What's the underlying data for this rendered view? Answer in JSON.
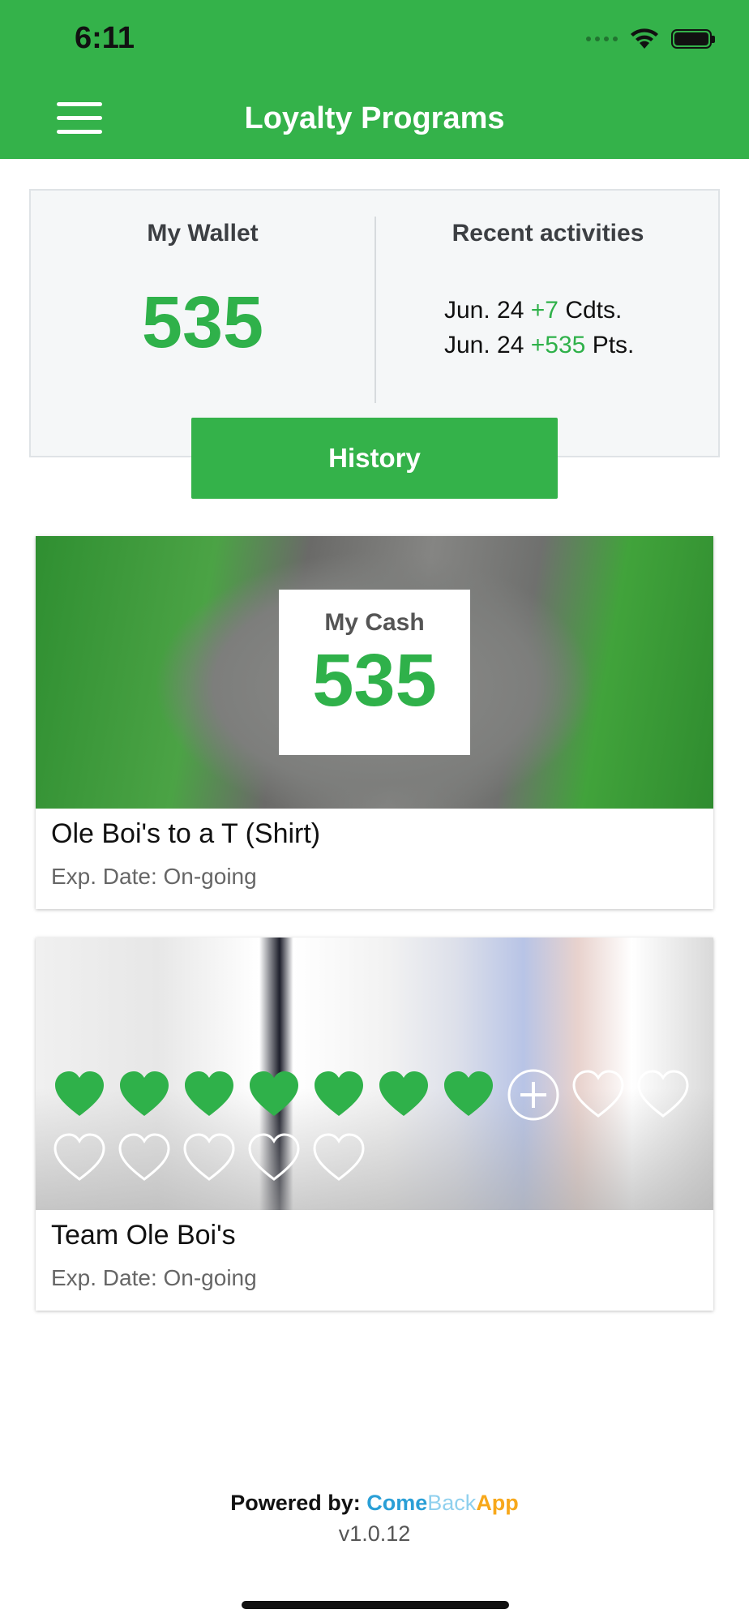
{
  "status_bar": {
    "time": "6:11"
  },
  "header": {
    "title": "Loyalty Programs"
  },
  "wallet": {
    "label": "My Wallet",
    "value": "535",
    "recent_label": "Recent activities",
    "activities": [
      {
        "date": "Jun. 24",
        "amount": "+7",
        "unit": "Cdts."
      },
      {
        "date": "Jun. 24",
        "amount": "+535",
        "unit": "Pts."
      }
    ],
    "history_button": "History"
  },
  "programs": [
    {
      "cash_label": "My Cash",
      "cash_value": "535",
      "title": "Ole Boi's to a T (Shirt)",
      "expiry": "Exp. Date: On-going"
    },
    {
      "title": "Team Ole Boi's",
      "expiry": "Exp. Date: On-going",
      "stamps_filled": 7,
      "stamps_total": 15
    }
  ],
  "footer": {
    "powered_by": "Powered by:",
    "brand_come": "Come",
    "brand_back": "Back",
    "brand_app": "App",
    "version": "v1.0.12"
  },
  "colors": {
    "accent": "#34b24a",
    "value_green": "#2fb14a"
  },
  "icons": [
    "menu-icon",
    "wifi-icon",
    "battery-icon",
    "heart-icon",
    "plus-icon"
  ]
}
